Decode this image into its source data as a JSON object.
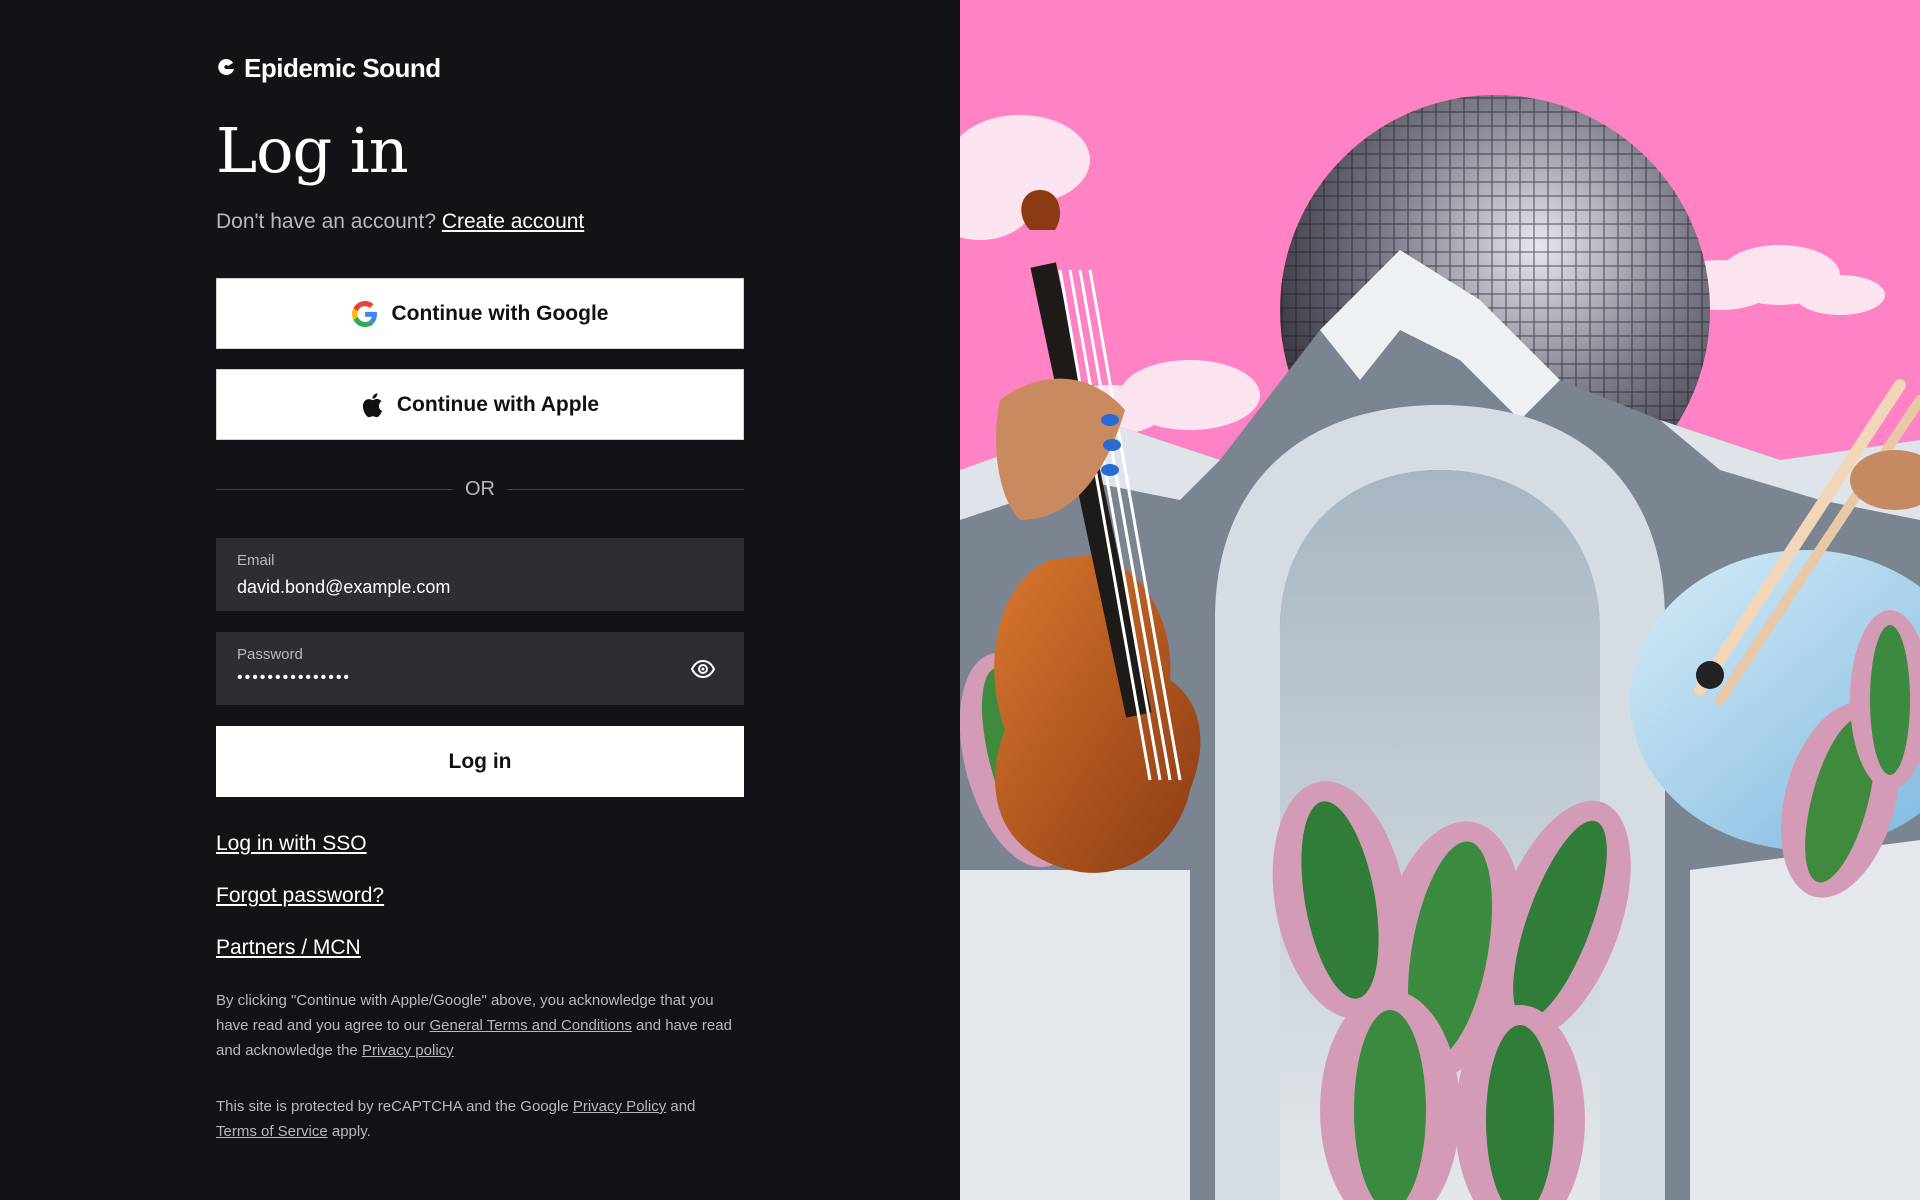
{
  "brand": {
    "name": "Epidemic Sound"
  },
  "page": {
    "title": "Log in",
    "no_account_text": "Don't have an account?",
    "create_account_link": "Create account"
  },
  "social": {
    "google_label": "Continue with Google",
    "apple_label": "Continue with Apple"
  },
  "divider": {
    "text": "OR"
  },
  "form": {
    "email_label": "Email",
    "email_value": "david.bond@example.com",
    "password_label": "Password",
    "password_value": "•••••••••••••••",
    "login_label": "Log in"
  },
  "links": {
    "sso": "Log in with SSO",
    "forgot": "Forgot password?",
    "partners": "Partners / MCN"
  },
  "legal": {
    "p1_a": "By clicking \"Continue with Apple/Google\" above, you acknowledge that you have read and you agree to our",
    "p1_link1": "General Terms and Conditions",
    "p1_b": "and have read and acknowledge the",
    "p1_link2": "Privacy policy",
    "p2_a": "This site is protected by reCAPTCHA and the Google",
    "p2_link1": "Privacy Policy",
    "p2_b": "and",
    "p2_link2": "Terms of Service",
    "p2_c": "apply."
  },
  "colors": {
    "background": "#121317",
    "field_bg": "#2c2e34",
    "muted_text": "#b8b9bd",
    "hero_pink": "#ff82c4"
  },
  "icons": {
    "logo": "epidemic-sound-logo-icon",
    "google": "google-icon",
    "apple": "apple-icon",
    "show_password": "eye-icon"
  }
}
